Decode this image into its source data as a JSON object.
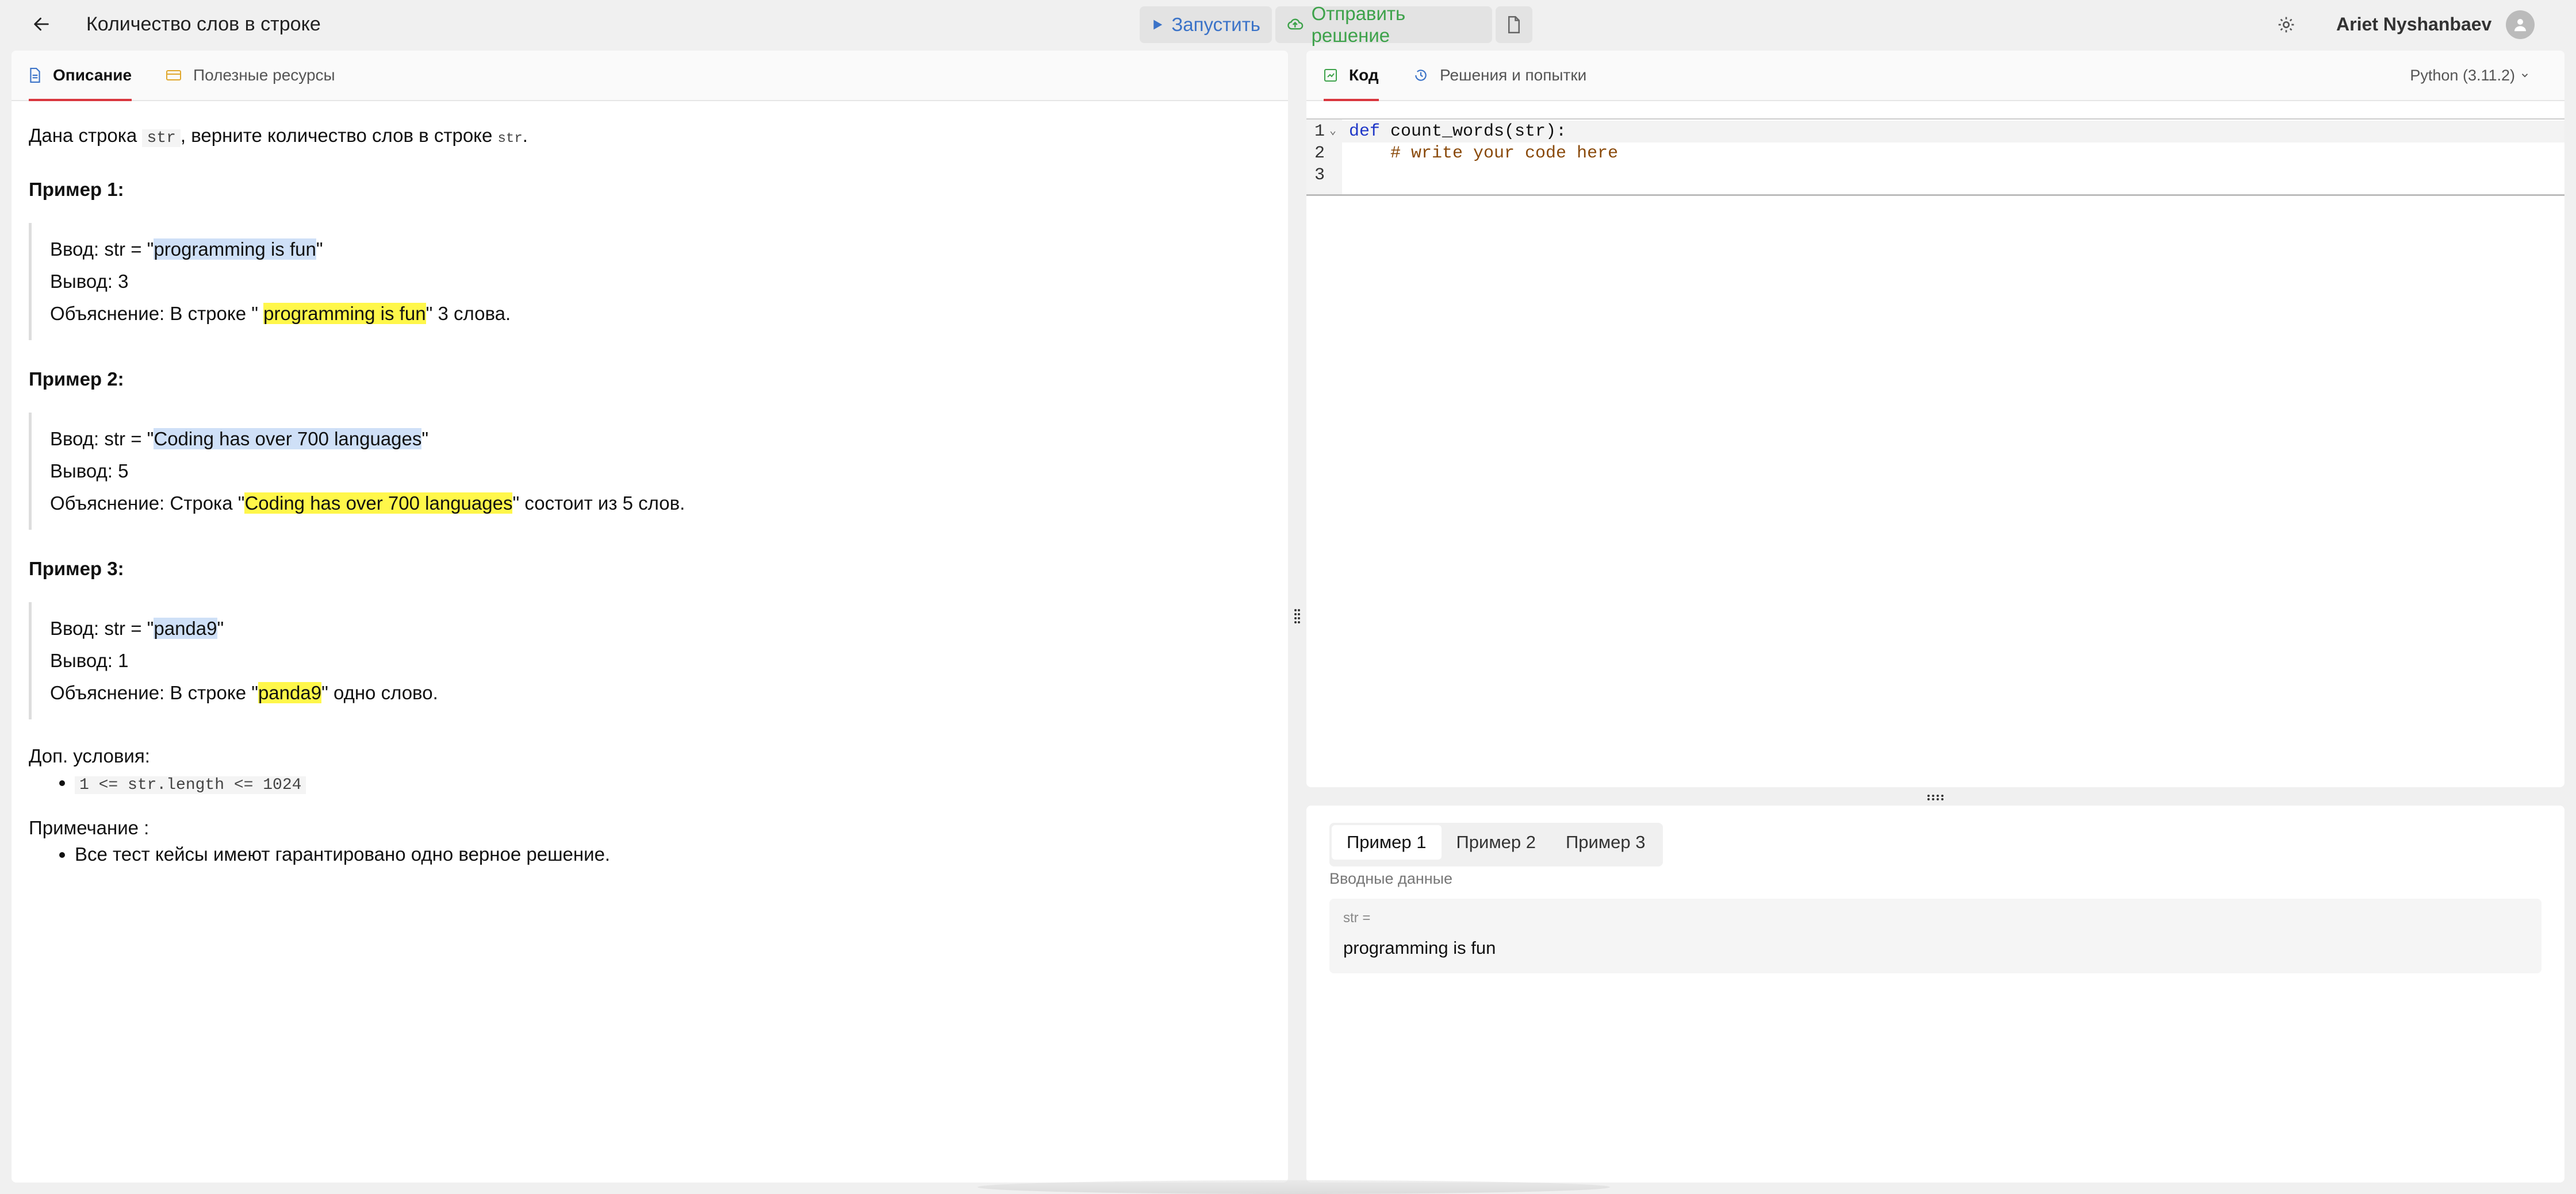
{
  "header": {
    "title": "Количество слов в строке",
    "run_label": "Запустить",
    "submit_label": "Отправить решение",
    "user_name": "Ariet Nyshanbaev"
  },
  "left_tabs": {
    "description": "Описание",
    "resources": "Полезные ресурсы"
  },
  "problem": {
    "intro_1": "Дана строка",
    "intro_code": "str",
    "intro_2": ", верните  количество слов в строке",
    "intro_code2": "str",
    "intro_3": ".",
    "examples": [
      {
        "heading": "Пример 1:",
        "input_prefix": "Ввод: str = \"",
        "input_value": "programming is fun",
        "input_suffix": "\"",
        "output": "Вывод: 3",
        "expl_prefix": "Объяснение: В строке \" ",
        "expl_value": "programming is fun",
        "expl_suffix": "\" 3 слова."
      },
      {
        "heading": "Пример 2:",
        "input_prefix": "Ввод: str = \"",
        "input_value": "Coding has over 700 languages",
        "input_suffix": "\"",
        "output": "Вывод: 5",
        "expl_prefix": "Объяснение: Строка \"",
        "expl_value": "Coding has over 700 languages",
        "expl_suffix": "\" состоит из 5 слов."
      },
      {
        "heading": "Пример 3:",
        "input_prefix": "Ввод: str = \"",
        "input_value": "panda9",
        "input_suffix": "\"",
        "output": "Вывод: 1",
        "expl_prefix": "Объяснение: В строке \"",
        "expl_value": "panda9",
        "expl_suffix": "\" одно слово."
      }
    ],
    "constraints_heading": "Доп. условия:",
    "constraint_1": "1 <= str.length <= 1024",
    "note_heading": "Примечание  :",
    "note_1": "Все тест кейсы имеют гарантировано одно верное решение."
  },
  "right_tabs": {
    "code": "Код",
    "attempts": "Решения и попытки",
    "language": "Python (3.11.2)"
  },
  "editor": {
    "lines": [
      {
        "num": "1",
        "kw": "def",
        "text": " count_words(str):"
      },
      {
        "num": "2",
        "text": "    # write your code here"
      },
      {
        "num": "3",
        "text": ""
      }
    ]
  },
  "testcases": {
    "tabs": [
      "Пример 1",
      "Пример 2",
      "Пример 3"
    ],
    "input_label": "Вводные данные",
    "var_name": "str =",
    "var_value": "programming is fun"
  },
  "colors": {
    "accent_red": "#d9363e",
    "run_blue": "#3b73c8",
    "submit_green": "#3da24a",
    "highlight_yellow": "#fff74a",
    "selection_blue": "#cfe0f7"
  }
}
